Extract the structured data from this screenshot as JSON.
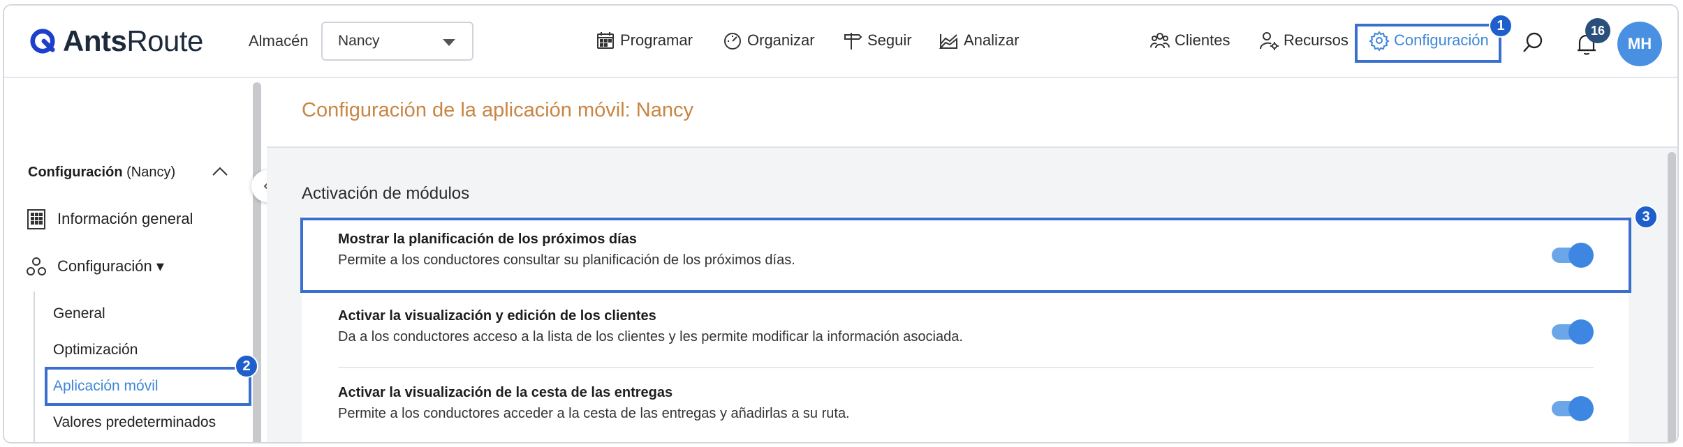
{
  "brand": {
    "name_bold": "Ants",
    "name_regular": "Route"
  },
  "header": {
    "warehouse_label": "Almacén",
    "warehouse_value": "Nancy",
    "nav": {
      "programar": "Programar",
      "organizar": "Organizar",
      "seguir": "Seguir",
      "analizar": "Analizar",
      "clientes": "Clientes",
      "recursos": "Recursos",
      "configuracion": "Configuración"
    },
    "notifications_count": "16",
    "avatar_initials": "MH"
  },
  "callouts": {
    "one": "1",
    "two": "2",
    "three": "3"
  },
  "sidebar": {
    "section_bold": "Configuración",
    "section_suffix": " (Nancy)",
    "general_info": "Información general",
    "config_group": "Configuración ▾",
    "items": [
      "General",
      "Optimización",
      "Aplicación móvil",
      "Valores predeterminados"
    ]
  },
  "main": {
    "title": "Configuración de la aplicación móvil: Nancy",
    "section": "Activación de módulos",
    "rows": [
      {
        "title": "Mostrar la planificación de los próximos días",
        "desc": "Permite a los conductores consultar su planificación de los próximos días.",
        "enabled": true
      },
      {
        "title": "Activar la visualización y edición de los clientes",
        "desc": "Da a los conductores acceso a la lista de los clientes y les permite modificar la información asociada.",
        "enabled": true
      },
      {
        "title": "Activar la visualización de la cesta de las entregas",
        "desc": "Permite a los conductores acceder a la cesta de las entregas y añadirlas a su ruta.",
        "enabled": true
      }
    ]
  },
  "colors": {
    "accent": "#3d87d8",
    "highlight": "#3a6fcf",
    "title_orange": "#c98543"
  }
}
